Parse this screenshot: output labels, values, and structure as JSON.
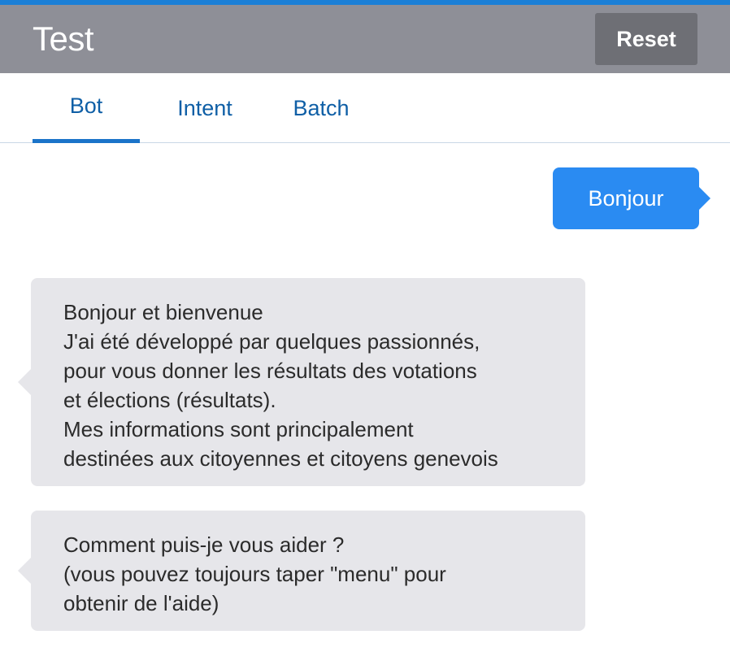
{
  "header": {
    "title": "Test",
    "reset_label": "Reset"
  },
  "tabs": [
    {
      "label": "Bot",
      "active": true
    },
    {
      "label": "Intent",
      "active": false
    },
    {
      "label": "Batch",
      "active": false
    }
  ],
  "conversation": {
    "user_message": "Bonjour",
    "bot_messages": [
      {
        "lines": [
          "Bonjour et bienvenue",
          "J'ai été développé par quelques passionnés,",
          "pour vous donner les résultats des votations",
          "et élections (résultats).",
          "Mes informations sont principalement",
          "destinées aux citoyennes et citoyens genevois"
        ]
      },
      {
        "lines": [
          "Comment puis-je vous aider ?",
          "(vous pouvez toujours taper \"menu\" pour",
          "obtenir de l'aide)"
        ]
      }
    ]
  },
  "colors": {
    "accent": "#1b7fd6",
    "header_bg": "#8e8f97",
    "user_bubble": "#2a8bf2",
    "bot_bubble": "#e6e6ea",
    "tab_text": "#0f5fa6"
  }
}
